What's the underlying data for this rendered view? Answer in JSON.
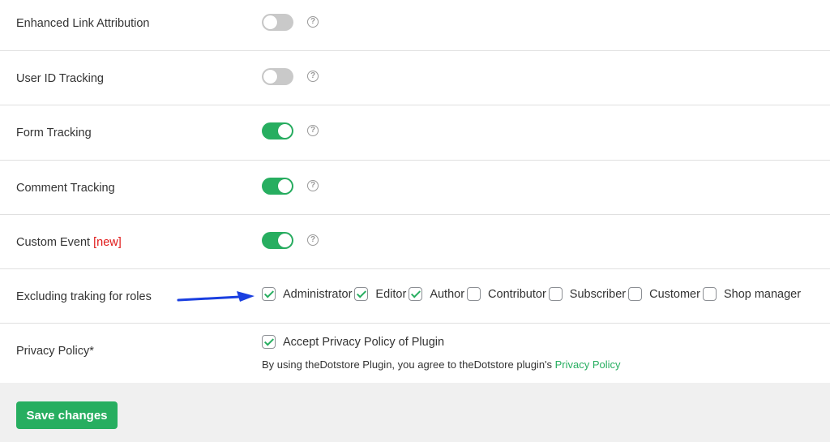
{
  "settings": [
    {
      "label": "Enhanced Link Attribution",
      "enabled": false,
      "help": "?"
    },
    {
      "label": "User ID Tracking",
      "enabled": false,
      "help": "?"
    },
    {
      "label": "Form Tracking",
      "enabled": true,
      "help": "?"
    },
    {
      "label": "Comment Tracking",
      "enabled": true,
      "help": "?"
    },
    {
      "label": "Custom Event",
      "badge": "[new]",
      "enabled": true,
      "help": "?"
    }
  ],
  "exclude_roles": {
    "label": "Excluding traking for roles",
    "roles": [
      {
        "label": "Administrator",
        "checked": true
      },
      {
        "label": "Editor",
        "checked": true
      },
      {
        "label": "Author",
        "checked": true
      },
      {
        "label": "Contributor",
        "checked": false
      },
      {
        "label": "Subscriber",
        "checked": false
      },
      {
        "label": "Customer",
        "checked": false
      },
      {
        "label": "Shop manager",
        "checked": false
      }
    ]
  },
  "privacy": {
    "label": "Privacy Policy*",
    "checkbox_label": "Accept Privacy Policy of Plugin",
    "checked": true,
    "note": "By using theDotstore Plugin, you agree to theDotstore plugin's ",
    "link_text": "Privacy Policy"
  },
  "footer": {
    "save_label": "Save changes"
  },
  "colors": {
    "accent": "#27ae60",
    "new_badge": "#e01818",
    "arrow": "#1a3fe0"
  }
}
